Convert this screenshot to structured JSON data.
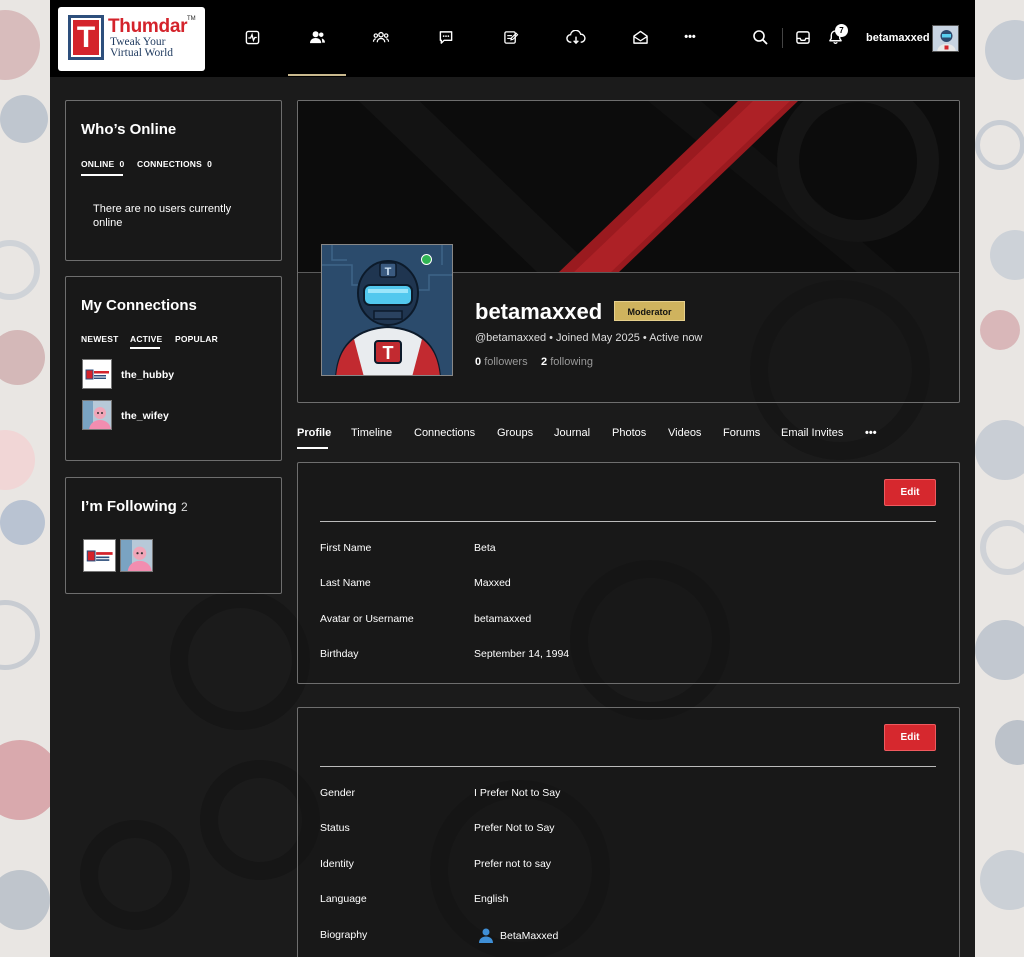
{
  "header": {
    "logo": {
      "letter": "T",
      "brand": "Thumdar",
      "tm": "TM",
      "tagline_1": "Tweak Your",
      "tagline_2": "Virtual World"
    },
    "nav_icons": [
      "activity-icon",
      "members-icon",
      "groups-icon",
      "forums-icon",
      "journal-icon",
      "downloads-icon",
      "messages-icon",
      "more-icon"
    ],
    "more_label": "•••",
    "notifications_count": "7",
    "username": "betamaxxed"
  },
  "whos_online": {
    "title": "Who’s Online",
    "tabs": [
      {
        "label": "ONLINE",
        "count": "0"
      },
      {
        "label": "CONNECTIONS",
        "count": "0"
      }
    ],
    "empty_line1": "There are no users currently",
    "empty_line2": "online"
  },
  "my_connections": {
    "title": "My Connections",
    "tabs": [
      "NEWEST",
      "ACTIVE",
      "POPULAR"
    ],
    "active_tab": "ACTIVE",
    "items": [
      {
        "name": "the_hubby"
      },
      {
        "name": "the_wifey"
      }
    ]
  },
  "following": {
    "title": "I’m Following",
    "count": "2"
  },
  "profile": {
    "name": "betamaxxed",
    "role": "Moderator",
    "meta": "@betamaxxed • Joined May 2025 • Active now",
    "followers_count": "0",
    "followers_label": "followers",
    "following_count": "2",
    "following_label": "following",
    "tabs": [
      "Profile",
      "Timeline",
      "Connections",
      "Groups",
      "Journal",
      "Photos",
      "Videos",
      "Forums",
      "Email Invites"
    ],
    "active_tab": "Profile",
    "tabs_more": "•••"
  },
  "section1": {
    "edit_label": "Edit",
    "fields": [
      {
        "label": "First Name",
        "value": "Beta"
      },
      {
        "label": "Last Name",
        "value": "Maxxed"
      },
      {
        "label": "Avatar or Username",
        "value": "betamaxxed"
      },
      {
        "label": "Birthday",
        "value": "September 14, 1994"
      }
    ]
  },
  "section2": {
    "edit_label": "Edit",
    "fields": [
      {
        "label": "Gender",
        "value": "I Prefer Not to Say"
      },
      {
        "label": "Status",
        "value": "Prefer Not to Say"
      },
      {
        "label": "Identity",
        "value": "Prefer not to say"
      },
      {
        "label": "Language",
        "value": "English"
      },
      {
        "label": "Biography",
        "value": "BetaMaxxed"
      }
    ]
  },
  "colors": {
    "accent_red": "#d6282e",
    "moderator_gold": "#cfb35e",
    "online_green": "#31b554",
    "background": "#1b1b1b"
  }
}
